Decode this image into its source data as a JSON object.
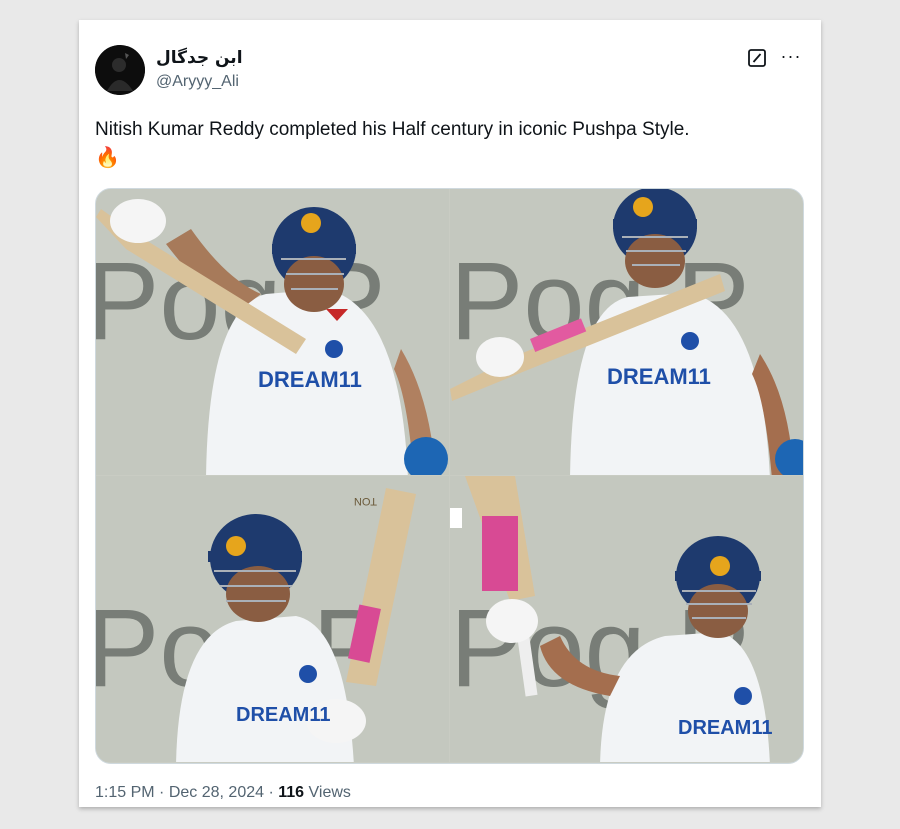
{
  "tweet": {
    "display_name": "ابن جدگال",
    "handle": "@Aryyy_Ali",
    "text": "Nitish Kumar Reddy completed his Half century in iconic Pushpa Style.",
    "emoji": "🔥",
    "time": "1:15 PM",
    "separator": "·",
    "date": "Dec 28, 2024",
    "views_count": "116",
    "views_label": "Views"
  },
  "actions": {
    "grok_icon": "grok-icon",
    "more_icon": "more-icon",
    "more_glyph": "···"
  },
  "media": {
    "photo_text": {
      "sponsor": "DREAM11",
      "backdrop": "Pog P",
      "bat_label": "TON"
    }
  },
  "colors": {
    "helmet": "#1e3a6e",
    "jersey": "#f2f4f6",
    "sponsor": "#1f4fa8",
    "handle_grey": "#536471"
  }
}
